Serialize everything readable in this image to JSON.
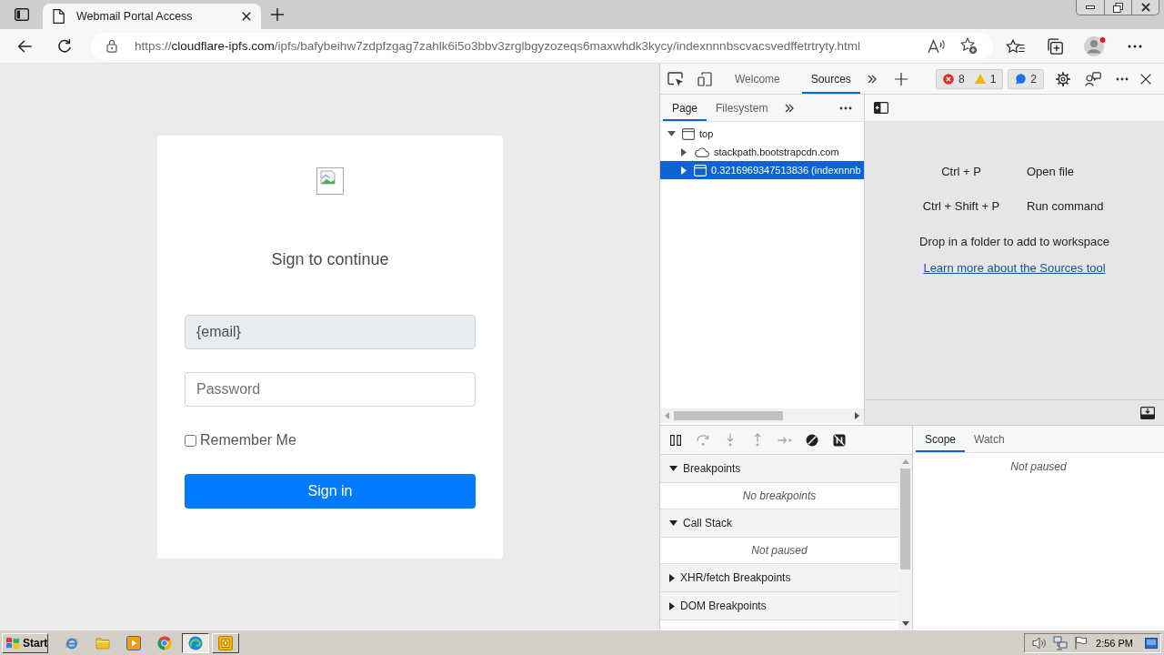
{
  "browser": {
    "tabs": [
      {
        "title": "Webmail Portal Access",
        "selected": true
      }
    ],
    "address": {
      "scheme": "https://",
      "host": "cloudflare-ipfs.com",
      "path": "/ipfs/bafybeihw7zdpfzgag7zahlk6i5o3bbv3zrglbgyzozeqs6maxwhdk3kycy/indexnnnbscvacsvedffetrtryty.html"
    }
  },
  "login": {
    "heading": "Sign to continue",
    "email": {
      "value": "{email}",
      "disabled": true
    },
    "password": {
      "placeholder": "Password"
    },
    "remember": {
      "label": "Remember Me",
      "checked": false
    },
    "submit": "Sign in"
  },
  "devtools": {
    "tabs": [
      {
        "label": "Welcome",
        "selected": false
      },
      {
        "label": "Sources",
        "selected": true
      }
    ],
    "issues": {
      "errors": "8",
      "warnings": "1",
      "messages": "2"
    },
    "navigator": {
      "tabs": [
        {
          "label": "Page",
          "selected": true
        },
        {
          "label": "Filesystem",
          "selected": false
        }
      ],
      "tree": [
        {
          "label": "top",
          "kind": "frame",
          "expanded": true,
          "selected": false,
          "children": [
            {
              "label": "stackpath.bootstrapcdn.com",
              "kind": "domain",
              "expanded": false,
              "selected": false
            },
            {
              "label": "0.3216969347513836 (indexnnnb",
              "kind": "frame",
              "expanded": false,
              "selected": true
            }
          ]
        }
      ]
    },
    "editor": {
      "shortcuts": [
        {
          "keys": "Ctrl + P",
          "action": "Open file"
        },
        {
          "keys": "Ctrl + Shift + P",
          "action": "Run command"
        }
      ],
      "hint": "Drop in a folder to add to workspace",
      "link": "Learn more about the Sources tool"
    },
    "debugger": {
      "controls": [
        {
          "kind": "pause",
          "disabled": false
        },
        {
          "kind": "step-over",
          "disabled": true
        },
        {
          "kind": "step-into",
          "disabled": true
        },
        {
          "kind": "step-out",
          "disabled": true
        },
        {
          "kind": "step",
          "disabled": true
        },
        {
          "kind": "deactivate",
          "disabled": false
        },
        {
          "kind": "pause-exceptions",
          "disabled": false
        }
      ],
      "sections": [
        {
          "title": "Breakpoints",
          "expanded": true,
          "message": "No breakpoints"
        },
        {
          "title": "Call Stack",
          "expanded": true,
          "message": "Not paused"
        },
        {
          "title": "XHR/fetch Breakpoints",
          "expanded": false
        },
        {
          "title": "DOM Breakpoints",
          "expanded": false
        }
      ],
      "side_tabs": [
        {
          "label": "Scope",
          "selected": true
        },
        {
          "label": "Watch",
          "selected": false
        }
      ],
      "side_message": "Not paused"
    }
  },
  "taskbar": {
    "start": "Start",
    "quick_launch": [
      {
        "kind": "e-globe"
      },
      {
        "kind": "folder"
      },
      {
        "kind": "play"
      },
      {
        "kind": "color-wheel"
      }
    ],
    "tasks": [
      {
        "kind": "swirl",
        "selected": true
      },
      {
        "kind": "o-tile",
        "selected": false
      }
    ],
    "clock": "2:56 PM"
  }
}
